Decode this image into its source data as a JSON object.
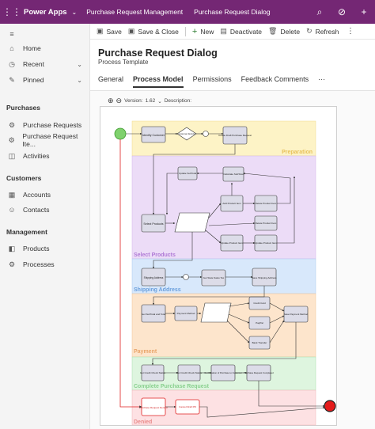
{
  "appbar": {
    "app_name": "Power Apps",
    "breadcrumb_1": "Purchase Request Management",
    "breadcrumb_2": "Purchase Request Dialog"
  },
  "nav": {
    "home": "Home",
    "recent": "Recent",
    "pinned": "Pinned",
    "section_purchases": "Purchases",
    "purchase_requests": "Purchase Requests",
    "purchase_request_items": "Purchase Request Ite...",
    "activities": "Activities",
    "section_customers": "Customers",
    "accounts": "Accounts",
    "contacts": "Contacts",
    "section_management": "Management",
    "products": "Products",
    "processes": "Processes"
  },
  "commands": {
    "save": "Save",
    "save_close": "Save & Close",
    "new": "New",
    "deactivate": "Deactivate",
    "delete": "Delete",
    "refresh": "Refresh"
  },
  "form": {
    "title": "Purchase Request Dialog",
    "subtitle": "Process Template",
    "tabs": [
      "General",
      "Process Model",
      "Permissions",
      "Feedback Comments"
    ],
    "active_tab": "Process Model"
  },
  "diagram": {
    "version_label": "Version:",
    "version_value": "1.62",
    "description_label": "Description:",
    "lanes": [
      "Preparation",
      "Select Products",
      "Shipping Address",
      "Payment",
      "Complete Purchase Request",
      "Denied"
    ],
    "lane_colors": [
      "#fdf3c6",
      "#ecdcf7",
      "#d8e8fb",
      "#fde5cc",
      "#def5df",
      "#fde1e3"
    ],
    "lane_label_colors": [
      "#e8c15a",
      "#b07ad6",
      "#6a9fdc",
      "#e9a56a",
      "#8ad08f",
      "#e98a8a"
    ],
    "tasks": {
      "identify_customer": "Identify Customer",
      "customer_exists": "Customer Exists?",
      "create_draft": "Create Draft Purchase Request",
      "update_subtotal": "Update SubTotal",
      "calculate_subtotal": "Calculate SubTotal",
      "add_product_item": "Add Product Item",
      "delete_product_item": "Delete Product Item",
      "select_products": "Select Products",
      "update_product_item": "Update Product Item",
      "update_product": "Update Product Item",
      "shipping_address": "Shipping Address",
      "get_state_sales_tax": "Get State Sales Tax",
      "save_shipping": "Save Shipping Address",
      "get_subtotal": "Get SubTotal and Total",
      "payment_method": "Payment Method",
      "credit_card": "Credit Card",
      "paypal": "PayPal",
      "bank_transfer": "Bank Transfer",
      "save_payment": "Save Payment Method",
      "get_credit_check": "Get Credit Check Status",
      "get_credit_check_2": "Get Credit Check Status",
      "confirmation": "Confirmation of Purchase to Customer",
      "purchase_completed": "Purchase Request Completed",
      "purchase_denied": "Purchase Request Denied",
      "cancel_draft": "Cancel Draft PR"
    },
    "gateway_labels": {
      "yes": "Yes",
      "no": "No",
      "ship_yes": "Ship",
      "pay_label_1": "Credit Card",
      "pay_label_2": "PayPal",
      "pay_label_3": "Bank Transfer"
    }
  }
}
